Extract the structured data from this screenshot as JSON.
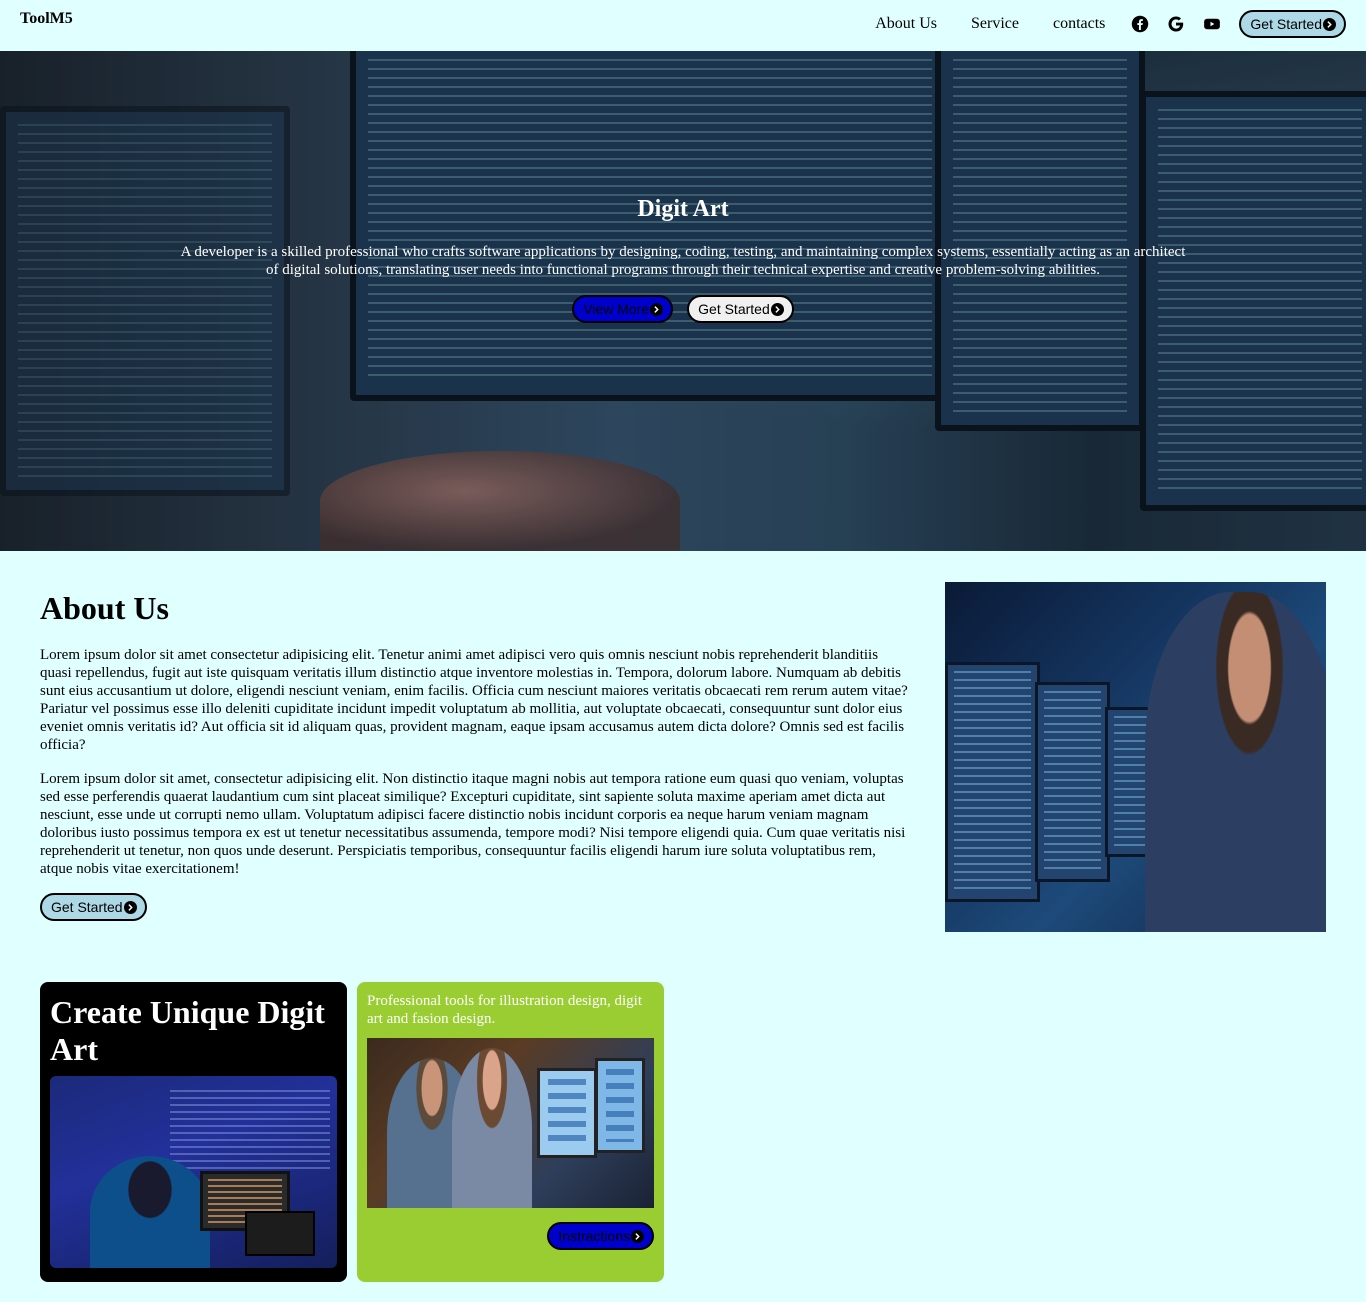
{
  "header": {
    "brand": "ToolM5",
    "nav": [
      "About Us",
      "Service",
      "contacts"
    ],
    "social_icons": [
      "facebook-icon",
      "google-icon",
      "youtube-icon"
    ],
    "cta_label": "Get Started"
  },
  "hero": {
    "title": "Digit Art",
    "description": "A developer is a skilled professional who crafts software applications by designing, coding, testing, and maintaining complex systems, essentially acting as an architect of digital solutions, translating user needs into functional programs through their technical expertise and creative problem-solving abilities.",
    "view_more_label": "View More",
    "get_started_label": "Get Started"
  },
  "about": {
    "title": "About Us",
    "paragraph1": "Lorem ipsum dolor sit amet consectetur adipisicing elit. Tenetur animi amet adipisci vero quis omnis nesciunt nobis reprehenderit blanditiis quasi repellendus, fugit aut iste quisquam veritatis illum distinctio atque inventore molestias in. Tempora, dolorum labore. Numquam ab debitis sunt eius accusantium ut dolore, eligendi nesciunt veniam, enim facilis. Officia cum nesciunt maiores veritatis obcaecati rem rerum autem vitae? Pariatur vel possimus esse illo deleniti cupiditate incidunt impedit voluptatum ab mollitia, aut voluptate obcaecati, consequuntur sunt dolor eius eveniet omnis veritatis id? Aut officia sit id aliquam quas, provident magnam, eaque ipsam accusamus autem dicta dolore? Omnis sed est facilis officia?",
    "paragraph2": "Lorem ipsum dolor sit amet, consectetur adipisicing elit. Non distinctio itaque magni nobis aut tempora ratione eum quasi quo veniam, voluptas sed esse perferendis quaerat laudantium cum sint placeat similique? Excepturi cupiditate, sint sapiente soluta maxime aperiam amet dicta aut nesciunt, esse unde ut corrupti nemo ullam. Voluptatum adipisci facere distinctio nobis incidunt corporis ea neque harum veniam magnam doloribus iusto possimus tempora ex est ut tenetur necessitatibus assumenda, tempore modi? Nisi tempore eligendi quia. Cum quae veritatis nisi reprehenderit ut tenetur, non quos unde deserunt. Perspiciatis temporibus, consequuntur facilis eligendi harum iure soluta voluptatibus rem, atque nobis vitae exercitationem!",
    "cta_label": "Get Started"
  },
  "cards": {
    "create": {
      "title": "Create Unique Digit Art"
    },
    "tools": {
      "text": "Professional tools for illustration design, digit art and fasion design.",
      "button_label": "Instractions"
    }
  },
  "colors": {
    "background": "#e0ffff",
    "cta_blue": "#add8e6",
    "card_green": "#9acd32",
    "instructions_button": "#0000cd"
  }
}
